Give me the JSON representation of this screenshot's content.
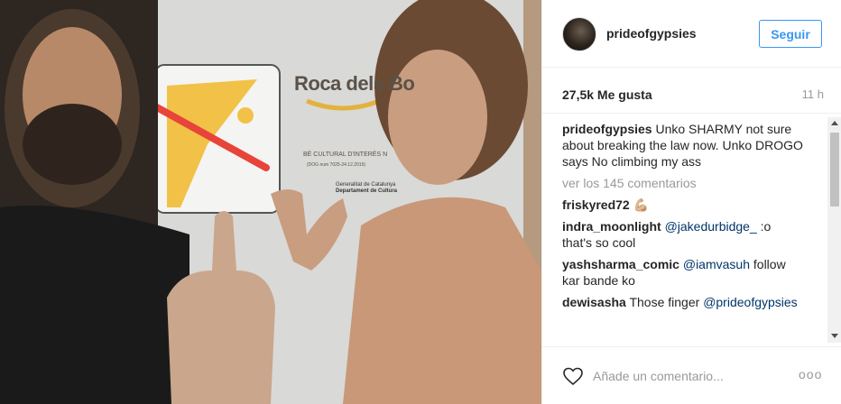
{
  "post": {
    "sign": {
      "title": "Roca dels Bo",
      "subtitle": "BÈ CULTURAL D'INTERÈS N",
      "decree": "(DOG num 7025-24.12.2015)",
      "gen_line1": "Generalitat de Catalunya",
      "gen_line2": "Departament de Cultura"
    }
  },
  "header": {
    "username": "prideofgypsies",
    "follow_label": "Seguir"
  },
  "stats": {
    "likes": "27,5k Me gusta",
    "time": "11 h"
  },
  "caption": {
    "username": "prideofgypsies",
    "text": " Unko SHARMY not sure about breaking the law now. Unko DROGO says No climbing my ass"
  },
  "view_more": "ver los 145 comentarios",
  "comments": [
    {
      "username": "friskyred72",
      "text": " 💪🏼",
      "mention": "",
      "after": ""
    },
    {
      "username": "indra_moonlight",
      "text": " ",
      "mention": "@jakedurbidge_",
      "after": " :o that's so cool"
    },
    {
      "username": "yashsharma_comic",
      "text": " ",
      "mention": "@iamvasuh",
      "after": " follow kar bande ko"
    },
    {
      "username": "dewisasha",
      "text": " Those finger ",
      "mention": "@prideofgypsies",
      "after": ""
    }
  ],
  "footer": {
    "comment_placeholder": "Añade un comentario...",
    "options_label": "ooo"
  },
  "icons": {
    "like": "heart-icon",
    "options": "more-options-icon"
  },
  "colors": {
    "accent": "#3897f0",
    "mention": "#003569",
    "muted": "#999999"
  }
}
